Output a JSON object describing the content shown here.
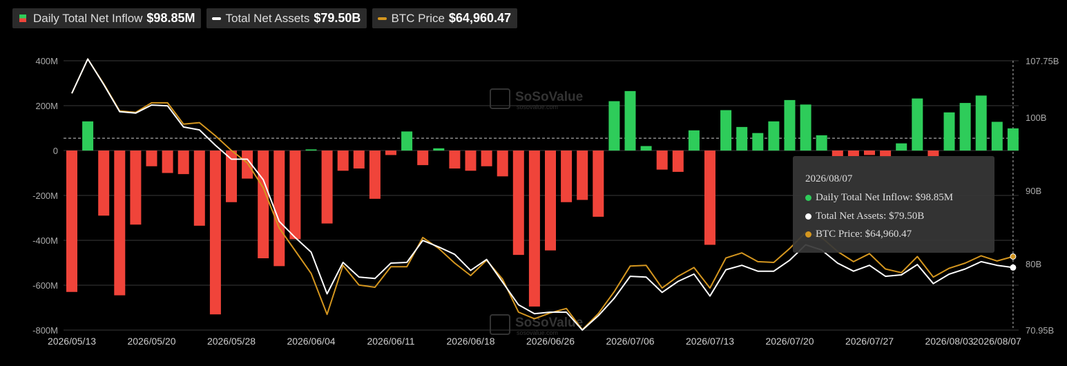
{
  "legend": {
    "inflow_label": "Daily Total Net Inflow",
    "inflow_value": "$98.85M",
    "assets_label": "Total Net Assets",
    "assets_value": "$79.50B",
    "btc_label": "BTC Price",
    "btc_value": "$64,960.47"
  },
  "watermark": {
    "name": "SoSoValue",
    "url": "sosovalue.com"
  },
  "tooltip": {
    "date": "2026/08/07",
    "inflow": "Daily Total Net Inflow: $98.85M",
    "assets": "Total Net Assets: $79.50B",
    "btc": "BTC Price: $64,960.47"
  },
  "colors": {
    "positive": "#2ecc5a",
    "negative": "#f0443a",
    "assets_line": "#ffffff",
    "btc_line": "#d4961f",
    "grid": "#3a3a3a",
    "axis_text": "#aaaaaa"
  },
  "chart_data": {
    "type": "bar",
    "title": "",
    "xlabel": "",
    "ylabel": "",
    "ylim": [
      -800,
      400
    ],
    "y_unit": "M",
    "y2lim": [
      70.95,
      107.75
    ],
    "y_tick_labels": [
      "400M",
      "200M",
      "0",
      "-200M",
      "-400M",
      "-600M",
      "-800M"
    ],
    "y2_tick_labels": [
      "107.75B",
      "100B",
      "90B",
      "80B",
      "70.95B"
    ],
    "y2_tick_values": [
      107.75,
      100,
      90,
      80,
      70.95
    ],
    "x_tick_labels": [
      "2026/05/13",
      "2026/05/20",
      "2026/05/28",
      "2026/06/04",
      "2026/06/11",
      "2026/06/18",
      "2026/06/26",
      "2026/07/06",
      "2026/07/13",
      "2026/07/20",
      "2026/07/27",
      "2026/08/03",
      "2026/08/07"
    ],
    "x_tick_indices": [
      0,
      5,
      10,
      15,
      20,
      25,
      30,
      35,
      40,
      45,
      50,
      55,
      58
    ],
    "reference_value": 55,
    "grid": true,
    "legend_position": "top-left",
    "series": [
      {
        "name": "Daily Total Net Inflow",
        "type": "bar",
        "unit": "M",
        "values": [
          -630,
          130,
          -290,
          -645,
          -330,
          -70,
          -100,
          -105,
          -335,
          -730,
          -230,
          -125,
          -480,
          -515,
          -395,
          5,
          -325,
          -90,
          -80,
          -215,
          -20,
          85,
          -65,
          10,
          -80,
          -90,
          -70,
          -115,
          -465,
          -695,
          -445,
          -230,
          -220,
          -295,
          220,
          265,
          20,
          -85,
          -95,
          90,
          -420,
          180,
          105,
          78,
          130,
          225,
          205,
          68,
          -25,
          -25,
          -20,
          -30,
          32,
          232,
          -25,
          170,
          212,
          245,
          128,
          98.85
        ]
      },
      {
        "name": "Total Net Assets",
        "type": "line",
        "unit": "B",
        "values": [
          103.3,
          108,
          104.5,
          100.8,
          100.6,
          101.7,
          101.6,
          98.7,
          98.3,
          96.2,
          94.3,
          94.3,
          91.5,
          85.8,
          83.6,
          81.6,
          75.9,
          80.2,
          78.2,
          78,
          80.1,
          80.2,
          83.2,
          82.3,
          81.3,
          79.1,
          80.6,
          77.5,
          74.4,
          73.2,
          73.4,
          73.4,
          70.95,
          72.9,
          75.3,
          78.3,
          78.2,
          76.1,
          77.6,
          78.6,
          75.6,
          79.2,
          79.8,
          79,
          79,
          80.5,
          82.6,
          81.9,
          80.1,
          79.0,
          79.8,
          78.3,
          78.5,
          79.9,
          77.3,
          78.6,
          79.3,
          80.3,
          79.8,
          79.5
        ]
      },
      {
        "name": "BTC Price",
        "type": "line",
        "unit": "B",
        "values": [
          103.3,
          108,
          104.6,
          100.9,
          100.7,
          102.0,
          102.0,
          99.1,
          99.3,
          97.5,
          95.5,
          93.8,
          90.4,
          84.9,
          81.8,
          78.7,
          73.1,
          79.8,
          77.1,
          76.8,
          79.6,
          79.6,
          83.6,
          82.1,
          80.1,
          78.4,
          80.5,
          77.9,
          73.4,
          72.5,
          73.3,
          73.9,
          71.0,
          73.2,
          76.2,
          79.7,
          79.8,
          76.7,
          78.3,
          79.5,
          76.7,
          80.8,
          81.5,
          80.3,
          80.2,
          82.1,
          84.3,
          83.6,
          81.7,
          80.3,
          81.4,
          79.3,
          78.8,
          81.0,
          78.2,
          79.4,
          80.1,
          81.1,
          80.4,
          81.0
        ]
      }
    ]
  }
}
